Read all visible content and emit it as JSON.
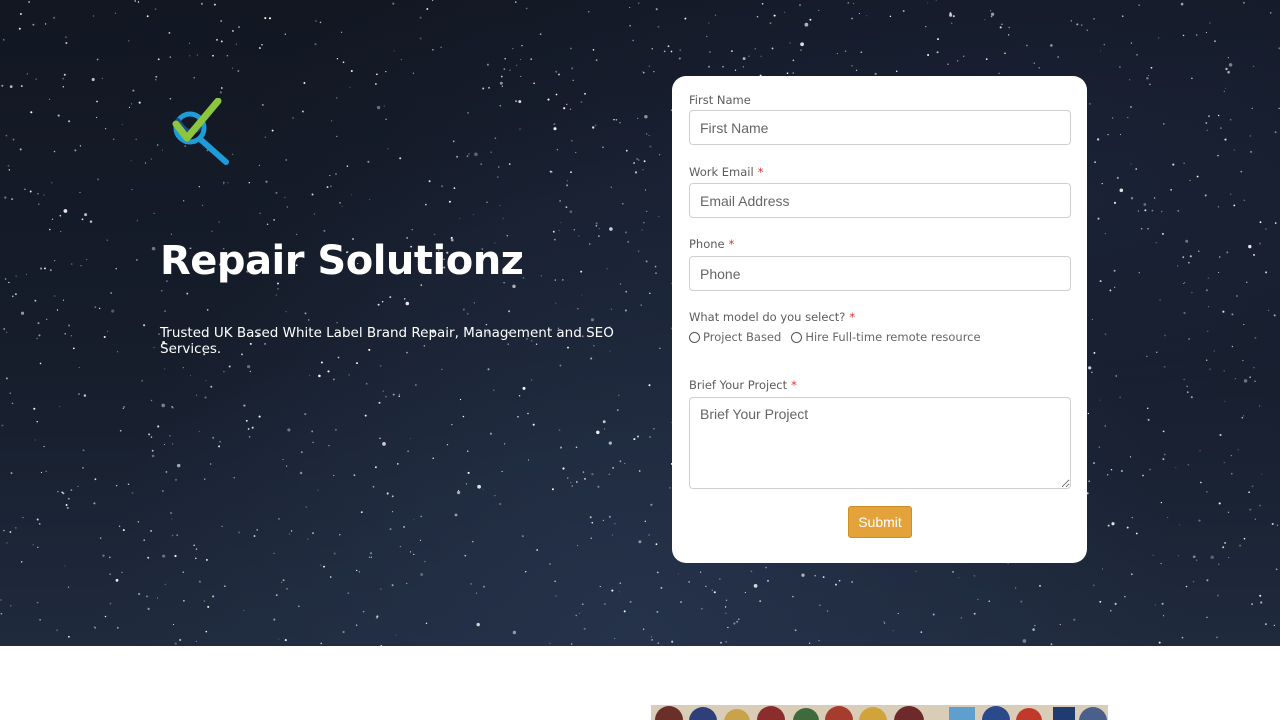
{
  "brand": {
    "title": "Repair Solutionz",
    "tagline": "Trusted UK Based White Label Brand Repair, Management and SEO Services.",
    "logo_icon": "checkmark-magnifier-logo"
  },
  "form": {
    "first_name": {
      "label": "First Name",
      "placeholder": "First Name",
      "required": false
    },
    "work_email": {
      "label": "Work Email",
      "placeholder": "Email Address",
      "required": true
    },
    "phone": {
      "label": "Phone",
      "placeholder": "Phone",
      "required": true
    },
    "model": {
      "label": "What model do you select?",
      "required": true,
      "options": [
        "Project Based",
        "Hire Full-time remote resource"
      ]
    },
    "brief": {
      "label": "Brief Your Project",
      "placeholder": "Brief Your Project",
      "required": true
    },
    "required_mark": "*",
    "submit_label": "Submit"
  },
  "colors": {
    "accent": "#e4a23a",
    "required": "#e03131",
    "hero_background": "#141a26",
    "logo_green": "#8cc63f",
    "logo_blue": "#1f9bd7"
  }
}
